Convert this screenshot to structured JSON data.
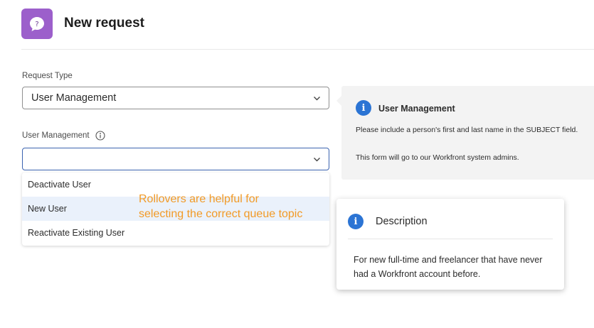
{
  "header": {
    "title": "New request",
    "icon": "question-bubble-icon",
    "icon_color": "#9c5fcb"
  },
  "form": {
    "request_type": {
      "label": "Request Type",
      "value": "User Management"
    },
    "user_management": {
      "label": "User Management",
      "value": "",
      "options": [
        "Deactivate User",
        "New User",
        "Reactivate Existing User"
      ],
      "highlighted_option": "New User"
    }
  },
  "annotation": {
    "line1": "Rollovers are helpful for",
    "line2": "selecting the correct queue topic",
    "color": "#f29a26"
  },
  "info_panel": {
    "title": "User Management",
    "line1": "Please include a person's first and last name in the SUBJECT field.",
    "line2": "This form will go to our Workfront system admins."
  },
  "description_card": {
    "title": "Description",
    "body": "For new full-time and freelancer that have never had a Workfront account before."
  },
  "colors": {
    "accent_blue": "#2b74d4",
    "focus_border": "#3b63b0",
    "hover_row": "#eaf1fb"
  }
}
